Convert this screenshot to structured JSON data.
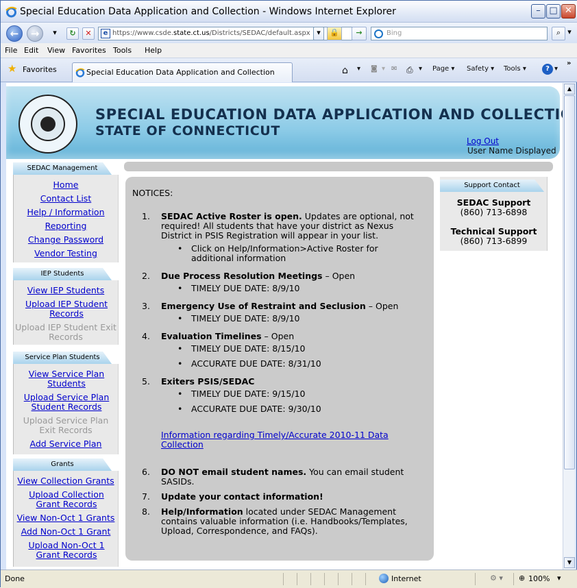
{
  "window": {
    "title": "Special Education Data Application and Collection - Windows Internet Explorer",
    "min_label": "–",
    "max_label": "□",
    "close_label": "✕"
  },
  "nav": {
    "back_glyph": "←",
    "forward_glyph": "→",
    "refresh_glyph": "↻",
    "stop_glyph": "✕",
    "address_prefix": "https://www.csde.",
    "address_domain": "state.ct.us",
    "address_path": "/Districts/SEDAC/default.aspx",
    "search_placeholder": "Bing"
  },
  "menu": [
    "File",
    "Edit",
    "View",
    "Favorites",
    "Tools",
    "Help"
  ],
  "favorites": {
    "label": "Favorites",
    "tab_title": "Special Education Data Application and Collection",
    "commands": [
      "Page ▾",
      "Safety ▾",
      "Tools ▾"
    ]
  },
  "banner": {
    "line1": "SPECIAL EDUCATION DATA APPLICATION AND COLLECTION",
    "line2": "STATE OF CONNECTICUT",
    "logout": "Log Out",
    "username": "User Name Displayed"
  },
  "sidebar": {
    "sections": [
      {
        "title": "SEDAC Management",
        "items": [
          {
            "label": "Home",
            "enabled": true
          },
          {
            "label": "Contact List",
            "enabled": true
          },
          {
            "label": "Help / Information",
            "enabled": true
          },
          {
            "label": "Reporting",
            "enabled": true
          },
          {
            "label": "Change Password",
            "enabled": true
          },
          {
            "label": "Vendor Testing",
            "enabled": true
          }
        ]
      },
      {
        "title": "IEP Students",
        "items": [
          {
            "label": "View IEP Students",
            "enabled": true
          },
          {
            "label": "Upload IEP Student Records",
            "enabled": true
          },
          {
            "label": "Upload IEP Student Exit Records",
            "enabled": false
          }
        ]
      },
      {
        "title": "Service Plan Students",
        "items": [
          {
            "label": "View Service Plan Students",
            "enabled": true
          },
          {
            "label": "Upload Service Plan Student Records",
            "enabled": true
          },
          {
            "label": "Upload Service Plan Exit Records",
            "enabled": false
          },
          {
            "label": "Add Service Plan",
            "enabled": true
          }
        ]
      },
      {
        "title": "Grants",
        "items": [
          {
            "label": "View Collection Grants",
            "enabled": true
          },
          {
            "label": "Upload Collection Grant Records",
            "enabled": true
          },
          {
            "label": "View Non-Oct 1 Grants",
            "enabled": true
          },
          {
            "label": "Add Non-Oct 1 Grant",
            "enabled": true
          },
          {
            "label": "Upload Non-Oct 1 Grant Records",
            "enabled": true
          }
        ]
      }
    ]
  },
  "notices": {
    "header": "NOTICES:",
    "n1_num": "1.",
    "n1_bold": "SEDAC Active Roster is open.",
    "n1_l1": " Updates are optional, not",
    "n1_l2": "required! All students that have your district as Nexus",
    "n1_l3": "District in PSIS Registration will appear in your list.",
    "n1_b1": "Click on Help/Information>Active Roster for",
    "n1_b2": "additional information",
    "n2_num": "2.",
    "n2_bold": "Due Process Resolution Meetings",
    "n2_rest": " – Open",
    "n2_b1": "TIMELY DUE DATE: 8/9/10",
    "n3_num": "3.",
    "n3_bold": "Emergency Use of Restraint and Seclusion",
    "n3_rest": " – Open",
    "n3_b1": "TIMELY DUE DATE: 8/9/10",
    "n4_num": "4.",
    "n4_bold": "Evaluation Timelines",
    "n4_rest": " – Open",
    "n4_b1": "TIMELY DUE DATE: 8/15/10",
    "n4_b2": "ACCURATE DUE DATE: 8/31/10",
    "n5_num": "5.",
    "n5_bold": "Exiters PSIS/SEDAC",
    "n5_b1": "TIMELY DUE DATE: 9/15/10",
    "n5_b2": "ACCURATE DUE DATE: 9/30/10",
    "link_l1": "Information regarding Timely/Accurate 2010-11 Data",
    "link_l2": "Collection",
    "n6_num": "6.",
    "n6_bold": "DO NOT email student names.",
    "n6_l1": " You can email student",
    "n6_l2": "SASIDs.",
    "n7_num": "7.",
    "n7_bold": "Update your contact information!",
    "n8_num": "8.",
    "n8_bold": "Help/Information",
    "n8_l1": " located under SEDAC Management",
    "n8_l2": "contains valuable information (i.e. Handbooks/Templates,",
    "n8_l3": "Upload, Correspondence, and FAQs)."
  },
  "support": {
    "title": "Support Contact",
    "sedac_label": "SEDAC Support",
    "sedac_phone": "(860) 713-6898",
    "tech_label": "Technical Support",
    "tech_phone": "(860) 713-6899"
  },
  "status": {
    "text": "Done",
    "zone": "Internet",
    "zoom": "100%"
  }
}
